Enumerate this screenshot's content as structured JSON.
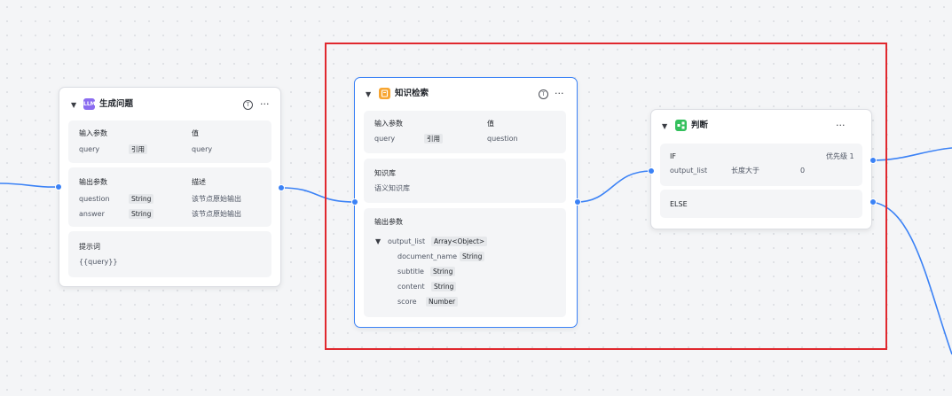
{
  "node_llm": {
    "icon_label": "LLM",
    "title": "生成问题",
    "inputs": {
      "header_param": "输入参数",
      "header_value": "值",
      "rows": [
        {
          "name": "query",
          "type": "引用",
          "value": "query"
        }
      ]
    },
    "outputs": {
      "header_param": "输出参数",
      "header_desc": "描述",
      "rows": [
        {
          "name": "question",
          "type": "String",
          "desc": "该节点原始输出"
        },
        {
          "name": "answer",
          "type": "String",
          "desc": "该节点原始输出"
        }
      ]
    },
    "prompt": {
      "label": "提示词",
      "value": "{{query}}"
    }
  },
  "node_knowledge": {
    "title": "知识检索",
    "inputs": {
      "header_param": "输入参数",
      "header_value": "值",
      "rows": [
        {
          "name": "query",
          "type": "引用",
          "value": "question"
        }
      ]
    },
    "kb": {
      "label": "知识库",
      "value": "语义知识库"
    },
    "outputs": {
      "header": "输出参数",
      "root": {
        "name": "output_list",
        "type": "Array<Object>"
      },
      "children": [
        {
          "name": "document_name",
          "type": "String"
        },
        {
          "name": "subtitle",
          "type": "String"
        },
        {
          "name": "content",
          "type": "String"
        },
        {
          "name": "score",
          "type": "Number"
        }
      ]
    }
  },
  "node_condition": {
    "title": "判断",
    "if_branch": {
      "label": "IF",
      "priority": "优先级 1",
      "variable": "output_list",
      "operator": "长度大于",
      "value": "0"
    },
    "else_branch": {
      "label": "ELSE"
    }
  },
  "controls": {
    "t_icon": "T",
    "more": "···",
    "caret": "▼"
  },
  "colors": {
    "accent": "#3b82f6",
    "selection": "#e0282e",
    "llm_icon": "#8b6cf0",
    "knowledge_icon": "#f7a531",
    "condition_icon": "#34c05d"
  }
}
